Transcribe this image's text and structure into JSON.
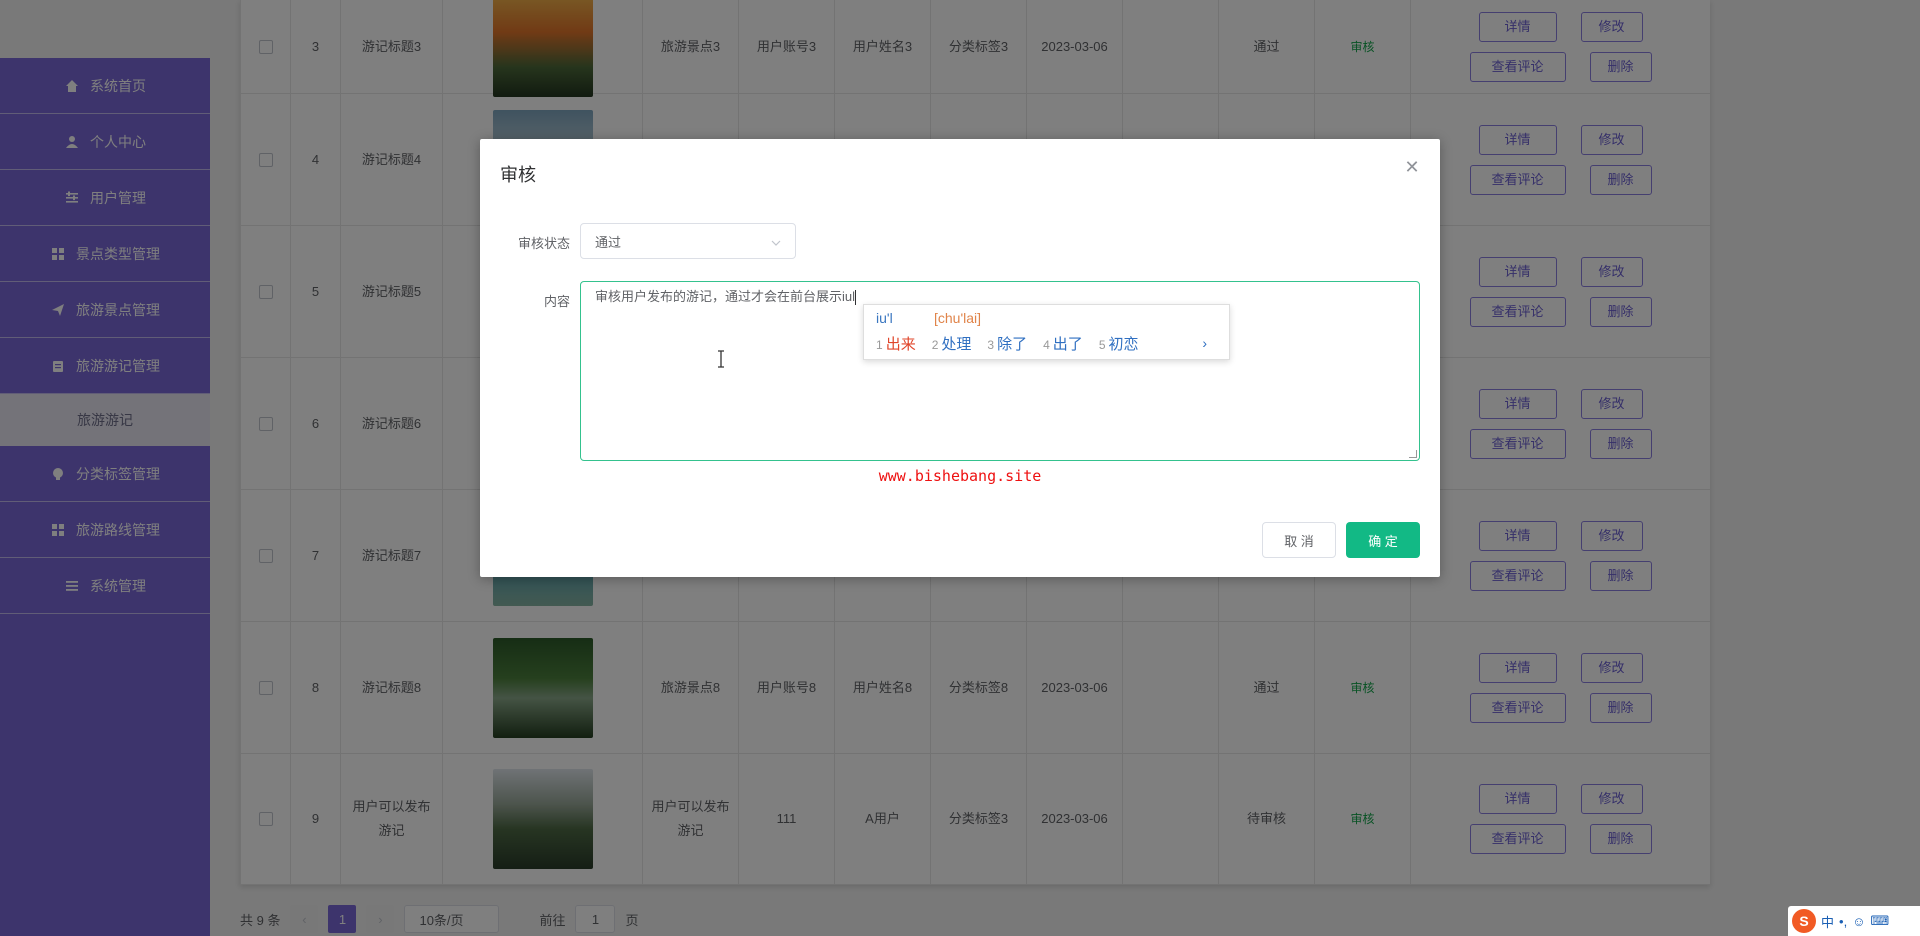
{
  "sidebar": {
    "items": [
      {
        "label": "系统首页",
        "icon": "home-icon"
      },
      {
        "label": "个人中心",
        "icon": "user-icon"
      },
      {
        "label": "用户管理",
        "icon": "sliders-icon"
      },
      {
        "label": "景点类型管理",
        "icon": "grid-icon"
      },
      {
        "label": "旅游景点管理",
        "icon": "send-icon"
      },
      {
        "label": "旅游游记管理",
        "icon": "clipboard-icon"
      },
      {
        "label": "旅游游记",
        "icon": ""
      },
      {
        "label": "分类标签管理",
        "icon": "bulb-icon"
      },
      {
        "label": "旅游路线管理",
        "icon": "grid-icon"
      },
      {
        "label": "系统管理",
        "icon": "list-icon"
      }
    ]
  },
  "table": {
    "rows": [
      {
        "index": "3",
        "title": "游记标题3",
        "spot": "旅游景点3",
        "account": "用户账号3",
        "name": "用户姓名3",
        "tag": "分类标签3",
        "date": "2023-03-06",
        "status": "通过",
        "audit": "审核",
        "img": "sunset"
      },
      {
        "index": "4",
        "title": "游记标题4",
        "spot": "",
        "account": "",
        "name": "",
        "tag": "",
        "date": "",
        "status": "",
        "audit": "",
        "img": "mountain"
      },
      {
        "index": "5",
        "title": "游记标题5",
        "spot": "",
        "account": "",
        "name": "",
        "tag": "",
        "date": "",
        "status": "",
        "audit": "",
        "img": ""
      },
      {
        "index": "6",
        "title": "游记标题6",
        "spot": "",
        "account": "",
        "name": "",
        "tag": "",
        "date": "",
        "status": "",
        "audit": "",
        "img": ""
      },
      {
        "index": "7",
        "title": "游记标题7",
        "spot": "",
        "account": "",
        "name": "",
        "tag": "",
        "date": "",
        "status": "",
        "audit": "",
        "img": "lake"
      },
      {
        "index": "8",
        "title": "游记标题8",
        "spot": "旅游景点8",
        "account": "用户账号8",
        "name": "用户姓名8",
        "tag": "分类标签8",
        "date": "2023-03-06",
        "status": "通过",
        "audit": "审核",
        "img": "waterfall"
      },
      {
        "index": "9",
        "title": "用户可以发布游记",
        "spot": "用户可以发布游记",
        "account": "111",
        "name": "A用户",
        "tag": "分类标签3",
        "date": "2023-03-06",
        "status": "待审核",
        "audit": "审核",
        "img": "karst"
      }
    ],
    "ops": {
      "detail": "详情",
      "edit": "修改",
      "comments": "查看评论",
      "delete": "删除"
    }
  },
  "pager": {
    "total": "共 9 条",
    "current_page": "1",
    "page_size": "10条/页",
    "goto_prefix": "前往",
    "goto_value": "1",
    "goto_suffix": "页"
  },
  "dialog": {
    "title": "审核",
    "status_label": "审核状态",
    "status_value": "通过",
    "content_label": "内容",
    "content_value": "审核用户发布的游记，通过才会在前台展示iul",
    "watermark": "www.bishebang.site",
    "cancel": "取 消",
    "confirm": "确 定"
  },
  "ime": {
    "composition": "iu'l",
    "pinyin": "[chu'lai]",
    "candidates": [
      {
        "n": "1",
        "w": "出来"
      },
      {
        "n": "2",
        "w": "处理"
      },
      {
        "n": "3",
        "w": "除了"
      },
      {
        "n": "4",
        "w": "出了"
      },
      {
        "n": "5",
        "w": "初恋"
      }
    ],
    "next": "›"
  },
  "tray": {
    "logo": "S",
    "lang": "中",
    "punct": "•,"
  },
  "colors": {
    "sidebar": "#7b68d9",
    "primary": "#12b985",
    "focus_border": "#34c28e",
    "watermark": "#ee1111"
  }
}
